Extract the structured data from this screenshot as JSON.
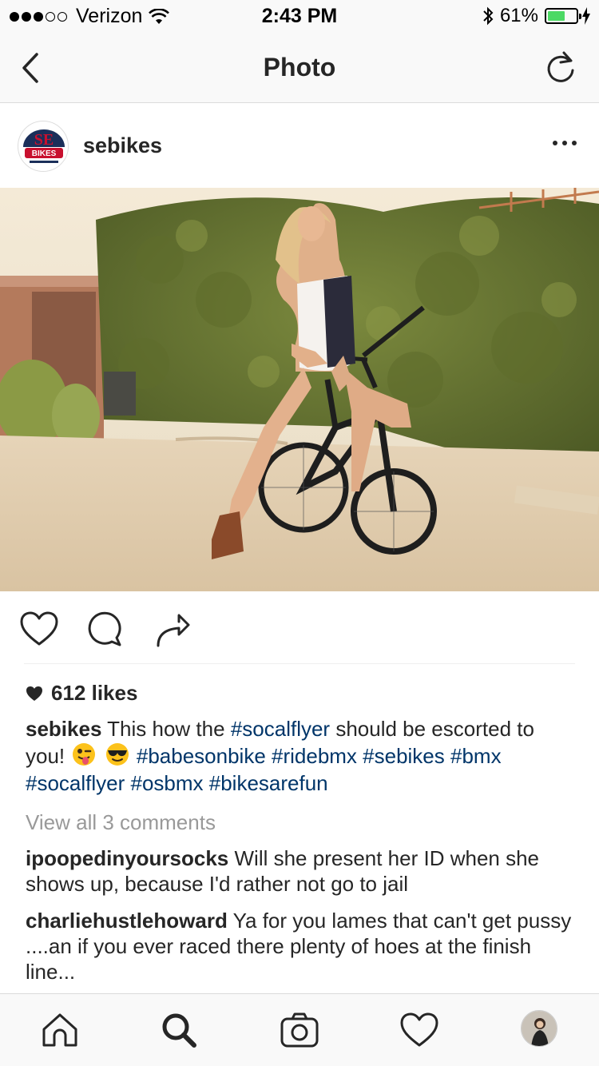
{
  "status_bar": {
    "carrier": "Verizon",
    "time": "2:43 PM",
    "battery_percent": "61%",
    "battery_level": 0.61,
    "signal_bars_filled": 3,
    "signal_bars_total": 5
  },
  "nav": {
    "title": "Photo",
    "back_icon": "chevron-left-icon",
    "refresh_icon": "refresh-icon"
  },
  "post": {
    "username": "sebikes",
    "avatar_text": "SE BIKES",
    "likes": "612 likes",
    "caption": {
      "username": "sebikes",
      "text_before": "This how the",
      "tag1": "#socalflyer",
      "text_after": "should be escorted to you!",
      "tags_rest": "#babesonbike #ridebmx #sebikes #bmx #socalflyer #osbmx #bikesarefun"
    },
    "view_all": "View all 3 comments",
    "comments": [
      {
        "username": "ipoopedinyoursocks",
        "text": "Will she present her ID when she shows up, because I'd rather not go to jail"
      },
      {
        "username": "charliehustlehoward",
        "text": "Ya for you lames that can't get pussy ....an if you ever raced there plenty of hoes at the finish line..."
      }
    ]
  },
  "colors": {
    "hashtag": "#003569",
    "bar_bg": "#f9f9f9",
    "battery": "#4cd964",
    "text": "#262626",
    "muted": "#999999"
  }
}
